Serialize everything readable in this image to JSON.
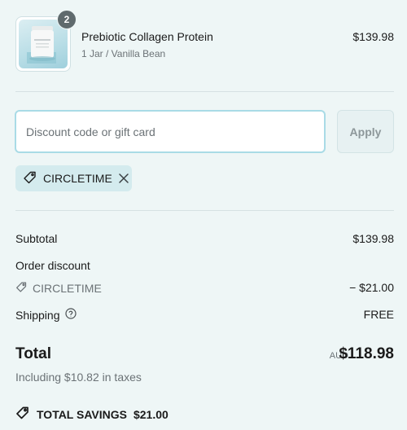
{
  "product": {
    "quantity": "2",
    "name": "Prebiotic Collagen Protein",
    "variant": "1 Jar / Vanilla Bean",
    "price": "$139.98"
  },
  "discount": {
    "placeholder": "Discount code or gift card",
    "value": "",
    "apply_label": "Apply",
    "applied_code": "CIRCLETIME"
  },
  "summary": {
    "subtotal_label": "Subtotal",
    "subtotal_value": "$139.98",
    "order_discount_label": "Order discount",
    "discount_code": "CIRCLETIME",
    "discount_value": "− $21.00",
    "shipping_label": "Shipping",
    "shipping_value": "FREE",
    "total_label": "Total",
    "currency": "AUD",
    "total_value": "$118.98",
    "taxes_note": "Including $10.82 in taxes",
    "savings_label": "TOTAL SAVINGS",
    "savings_value": "$21.00"
  },
  "colors": {
    "background": "#eef6f6",
    "input_border": "#a9dbe6",
    "chip_background": "#d4ebee",
    "badge": "#5f6a6d"
  },
  "icons": [
    "product-image",
    "tag-icon",
    "close-icon",
    "help-icon"
  ]
}
